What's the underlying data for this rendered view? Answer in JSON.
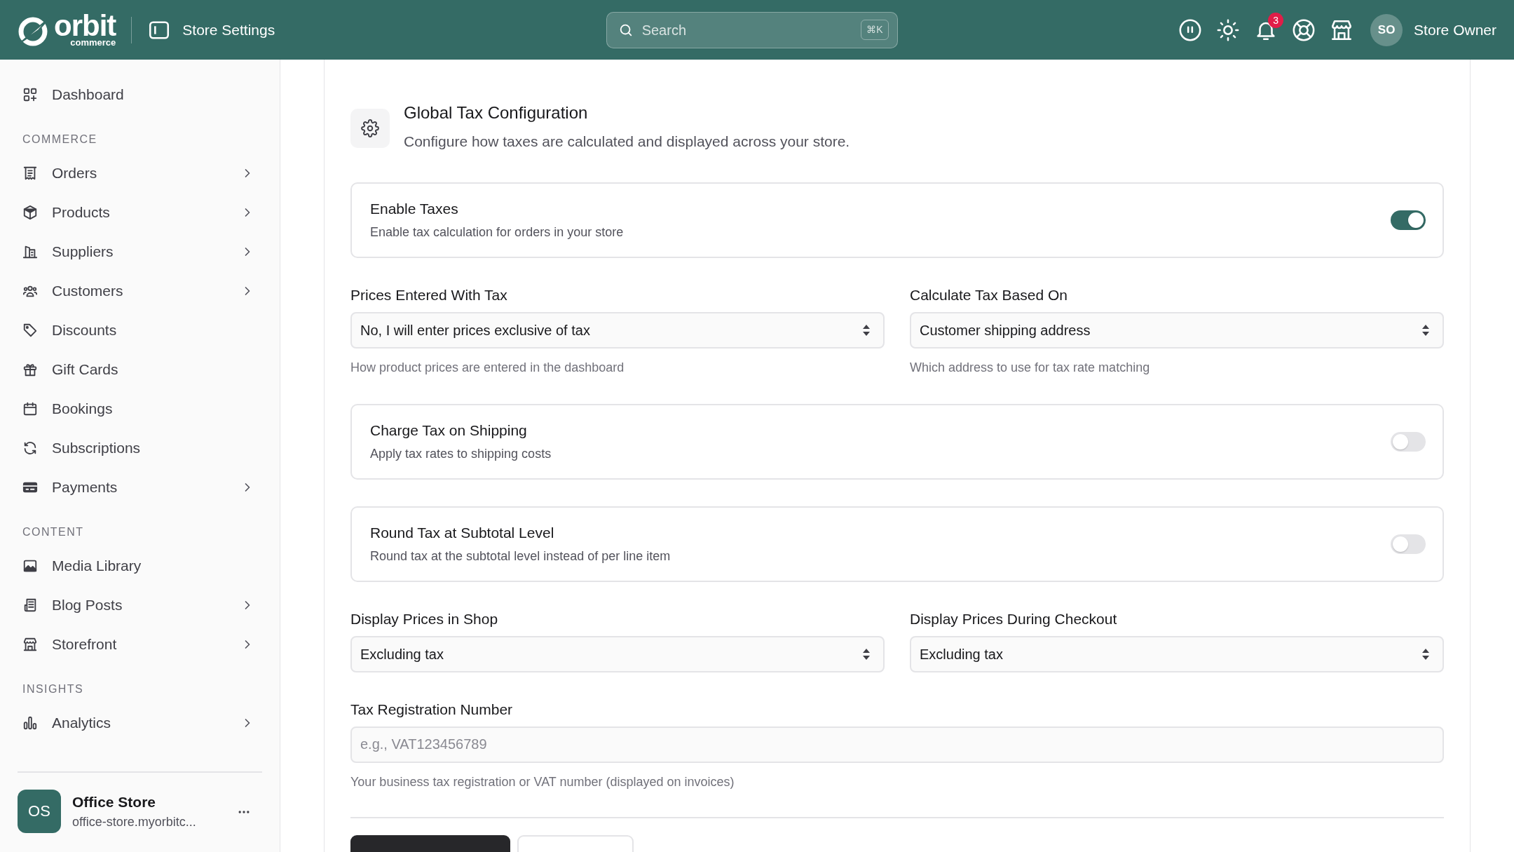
{
  "header": {
    "logo": {
      "name": "orbit",
      "tagline": "commerce"
    },
    "title": "Store Settings",
    "search": {
      "placeholder": "Search",
      "shortcut": "⌘K"
    },
    "notifications": {
      "count": "3"
    },
    "user": {
      "initials": "SO",
      "name": "Store Owner"
    }
  },
  "sidebar": {
    "sections": [
      {
        "items": [
          {
            "label": "Dashboard",
            "has_submenu": false
          }
        ]
      },
      {
        "heading": "COMMERCE",
        "items": [
          {
            "label": "Orders",
            "has_submenu": true
          },
          {
            "label": "Products",
            "has_submenu": true
          },
          {
            "label": "Suppliers",
            "has_submenu": true
          },
          {
            "label": "Customers",
            "has_submenu": true
          },
          {
            "label": "Discounts",
            "has_submenu": false
          },
          {
            "label": "Gift Cards",
            "has_submenu": false
          },
          {
            "label": "Bookings",
            "has_submenu": false
          },
          {
            "label": "Subscriptions",
            "has_submenu": false
          },
          {
            "label": "Payments",
            "has_submenu": true
          }
        ]
      },
      {
        "heading": "CONTENT",
        "items": [
          {
            "label": "Media Library",
            "has_submenu": false
          },
          {
            "label": "Blog Posts",
            "has_submenu": true
          },
          {
            "label": "Storefront",
            "has_submenu": true
          }
        ]
      },
      {
        "heading": "INSIGHTS",
        "items": [
          {
            "label": "Analytics",
            "has_submenu": true
          }
        ]
      }
    ],
    "store": {
      "initials": "OS",
      "name": "Office Store",
      "address": "office-store.myorbitc..."
    }
  },
  "panel": {
    "title": "Global Tax Configuration",
    "description": "Configure how taxes are calculated and displayed across your store.",
    "settings": [
      {
        "kind": "toggle",
        "title": "Enable Taxes",
        "description": "Enable tax calculation for orders in your store",
        "on": true
      },
      {
        "kind": "select_pair",
        "fields": [
          {
            "label": "Prices Entered With Tax",
            "value": "No, I will enter prices exclusive of tax",
            "help": "How product prices are entered in the dashboard"
          },
          {
            "label": "Calculate Tax Based On",
            "value": "Customer shipping address",
            "help": "Which address to use for tax rate matching"
          }
        ]
      },
      {
        "kind": "toggle",
        "title": "Charge Tax on Shipping",
        "description": "Apply tax rates to shipping costs",
        "on": false
      },
      {
        "kind": "toggle",
        "title": "Round Tax at Subtotal Level",
        "description": "Round tax at the subtotal level instead of per line item",
        "on": false
      },
      {
        "kind": "select_pair",
        "fields": [
          {
            "label": "Display Prices in Shop",
            "value": "Excluding tax"
          },
          {
            "label": "Display Prices During Checkout",
            "value": "Excluding tax"
          }
        ]
      },
      {
        "kind": "text_input",
        "label": "Tax Registration Number",
        "placeholder": "e.g., VAT123456789",
        "help": "Your business tax registration or VAT number (displayed on invoices)"
      }
    ],
    "actions": [
      {
        "kind": "primary"
      },
      {
        "kind": "secondary"
      }
    ]
  }
}
